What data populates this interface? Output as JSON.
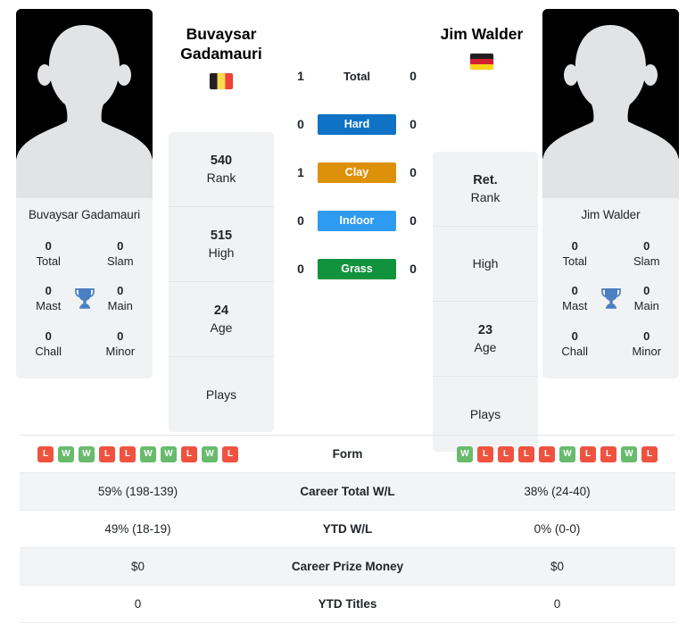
{
  "players": {
    "left": {
      "name": "Buvaysar Gadamauri",
      "first_name": "Buvaysar",
      "last_name": "Gadamauri",
      "country": "Belgium",
      "flag": "belgium-flag",
      "rank": "540",
      "rank_label": "Rank",
      "high": "515",
      "high_label": "High",
      "age": "24",
      "age_label": "Age",
      "plays": "",
      "plays_label": "Plays",
      "titles": {
        "total": "0",
        "total_label": "Total",
        "slam": "0",
        "slam_label": "Slam",
        "mast": "0",
        "mast_label": "Mast",
        "main": "0",
        "main_label": "Main",
        "chall": "0",
        "chall_label": "Chall",
        "minor": "0",
        "minor_label": "Minor"
      }
    },
    "right": {
      "name": "Jim Walder",
      "first_name": "Jim",
      "last_name": "Walder",
      "country": "Germany",
      "flag": "germany-flag",
      "rank": "Ret.",
      "rank_label": "Rank",
      "high": "",
      "high_label": "High",
      "age": "23",
      "age_label": "Age",
      "plays": "",
      "plays_label": "Plays",
      "titles": {
        "total": "0",
        "total_label": "Total",
        "slam": "0",
        "slam_label": "Slam",
        "mast": "0",
        "mast_label": "Mast",
        "main": "0",
        "main_label": "Main",
        "chall": "0",
        "chall_label": "Chall",
        "minor": "0",
        "minor_label": "Minor"
      }
    }
  },
  "h2h": {
    "rows": [
      {
        "label": "Total",
        "left": "1",
        "right": "0",
        "pill": false,
        "color": ""
      },
      {
        "label": "Hard",
        "left": "0",
        "right": "0",
        "pill": true,
        "color": "#0f72c4"
      },
      {
        "label": "Clay",
        "left": "1",
        "right": "0",
        "pill": true,
        "color": "#dd9009"
      },
      {
        "label": "Indoor",
        "left": "0",
        "right": "0",
        "pill": true,
        "color": "#2e9bf0"
      },
      {
        "label": "Grass",
        "left": "0",
        "right": "0",
        "pill": true,
        "color": "#11923d"
      }
    ]
  },
  "comparison": {
    "form_label": "Form",
    "form_left": [
      "L",
      "W",
      "W",
      "L",
      "L",
      "W",
      "W",
      "L",
      "W",
      "L"
    ],
    "form_right": [
      "W",
      "L",
      "L",
      "L",
      "L",
      "W",
      "L",
      "L",
      "W",
      "L"
    ],
    "rows": [
      {
        "label": "Career Total W/L",
        "left": "59% (198-139)",
        "right": "38% (24-40)"
      },
      {
        "label": "YTD W/L",
        "left": "49% (18-19)",
        "right": "0% (0-0)"
      },
      {
        "label": "Career Prize Money",
        "left": "$0",
        "right": "$0"
      },
      {
        "label": "YTD Titles",
        "left": "0",
        "right": "0"
      }
    ]
  },
  "colors": {
    "win": "#68bb6c",
    "loss": "#ef5340",
    "panel": "#f1f2f3",
    "text": "#212529"
  }
}
